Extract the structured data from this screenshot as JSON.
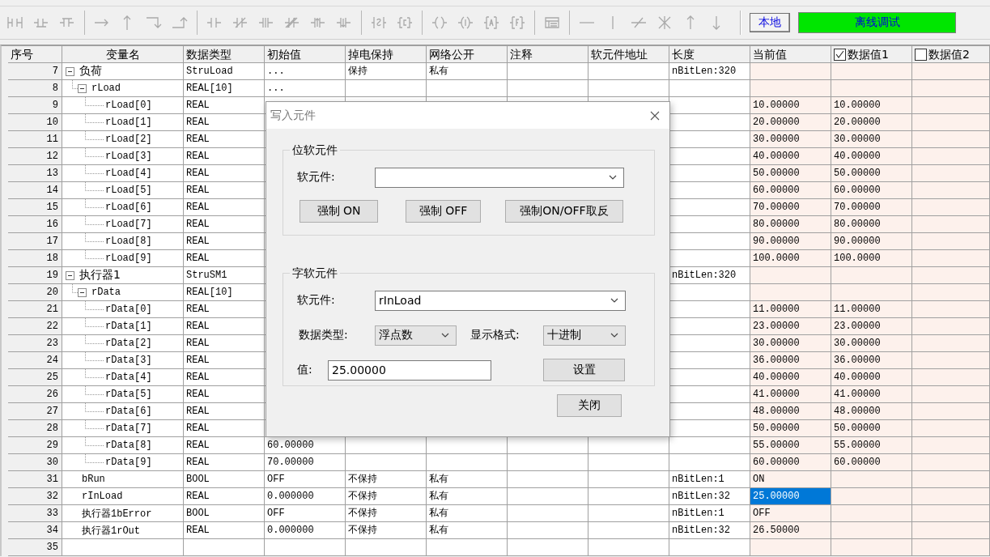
{
  "toolbar": {
    "location_button": "本地",
    "mode_status": "离线调试"
  },
  "table": {
    "columns": [
      {
        "label": "序号",
        "kind": "text"
      },
      {
        "label": "变量名",
        "kind": "text"
      },
      {
        "label": "数据类型",
        "kind": "text"
      },
      {
        "label": "初始值",
        "kind": "text"
      },
      {
        "label": "掉电保持",
        "kind": "text"
      },
      {
        "label": "网络公开",
        "kind": "text"
      },
      {
        "label": "注释",
        "kind": "text"
      },
      {
        "label": "软元件地址",
        "kind": "text"
      },
      {
        "label": "长度",
        "kind": "text"
      },
      {
        "label": "当前值",
        "kind": "text"
      },
      {
        "label": "数据值1",
        "kind": "checkbox",
        "checked": true
      },
      {
        "label": "数据值2",
        "kind": "checkbox",
        "checked": false
      }
    ],
    "rows": [
      {
        "no": "7",
        "name": "负荷",
        "type": "StruLoad",
        "init": "...",
        "retain": "保持",
        "public": "私有",
        "length": "nBitLen:320",
        "selected": false,
        "expanded": true,
        "children": [
          {
            "no": "8",
            "name": "rLoad",
            "type": "REAL[10]",
            "init": "...",
            "selected": false,
            "expanded": true,
            "children": [
              {
                "no": "9",
                "name": "rLoad[0]",
                "type": "REAL",
                "current": "10.00000",
                "data1": "10.00000",
                "selected": false
              },
              {
                "no": "10",
                "name": "rLoad[1]",
                "type": "REAL",
                "current": "20.00000",
                "data1": "20.00000",
                "selected": false
              },
              {
                "no": "11",
                "name": "rLoad[2]",
                "type": "REAL",
                "current": "30.00000",
                "data1": "30.00000",
                "selected": false
              },
              {
                "no": "12",
                "name": "rLoad[3]",
                "type": "REAL",
                "current": "40.00000",
                "data1": "40.00000",
                "selected": false
              },
              {
                "no": "13",
                "name": "rLoad[4]",
                "type": "REAL",
                "current": "50.00000",
                "data1": "50.00000",
                "selected": false
              },
              {
                "no": "14",
                "name": "rLoad[5]",
                "type": "REAL",
                "current": "60.00000",
                "data1": "60.00000",
                "selected": false
              },
              {
                "no": "15",
                "name": "rLoad[6]",
                "type": "REAL",
                "current": "70.00000",
                "data1": "70.00000",
                "selected": false
              },
              {
                "no": "16",
                "name": "rLoad[7]",
                "type": "REAL",
                "current": "80.00000",
                "data1": "80.00000",
                "selected": false
              },
              {
                "no": "17",
                "name": "rLoad[8]",
                "type": "REAL",
                "current": "90.00000",
                "data1": "90.00000",
                "selected": false
              },
              {
                "no": "18",
                "name": "rLoad[9]",
                "type": "REAL",
                "current": "100.0000",
                "data1": "100.0000",
                "selected": false
              }
            ]
          }
        ]
      },
      {
        "no": "19",
        "name": "执行器1",
        "type": "StruSM1",
        "length": "nBitLen:320",
        "selected": false,
        "expanded": true,
        "children": [
          {
            "no": "20",
            "name": "rData",
            "type": "REAL[10]",
            "selected": false,
            "expanded": true,
            "children": [
              {
                "no": "21",
                "name": "rData[0]",
                "type": "REAL",
                "current": "11.00000",
                "data1": "11.00000",
                "selected": false
              },
              {
                "no": "22",
                "name": "rData[1]",
                "type": "REAL",
                "current": "23.00000",
                "data1": "23.00000",
                "selected": false
              },
              {
                "no": "23",
                "name": "rData[2]",
                "type": "REAL",
                "current": "30.00000",
                "data1": "30.00000",
                "selected": false
              },
              {
                "no": "24",
                "name": "rData[3]",
                "type": "REAL",
                "current": "36.00000",
                "data1": "36.00000",
                "selected": false
              },
              {
                "no": "25",
                "name": "rData[4]",
                "type": "REAL",
                "current": "40.00000",
                "data1": "40.00000",
                "selected": false
              },
              {
                "no": "26",
                "name": "rData[5]",
                "type": "REAL",
                "current": "41.00000",
                "data1": "41.00000",
                "selected": false
              },
              {
                "no": "27",
                "name": "rData[6]",
                "type": "REAL",
                "current": "48.00000",
                "data1": "48.00000",
                "selected": false
              },
              {
                "no": "28",
                "name": "rData[7]",
                "type": "REAL",
                "current": "50.00000",
                "data1": "50.00000",
                "selected": false
              },
              {
                "no": "29",
                "name": "rData[8]",
                "type": "REAL",
                "init": "60.00000",
                "current": "55.00000",
                "data1": "55.00000",
                "selected": false
              },
              {
                "no": "30",
                "name": "rData[9]",
                "type": "REAL",
                "init": "70.00000",
                "current": "60.00000",
                "data1": "60.00000",
                "selected": false
              }
            ]
          }
        ]
      },
      {
        "no": "31",
        "name": "bRun",
        "type": "BOOL",
        "init": "OFF",
        "retain": "不保持",
        "public": "私有",
        "length": "nBitLen:1",
        "current": "ON",
        "selected": false
      },
      {
        "no": "32",
        "name": "rInLoad",
        "type": "REAL",
        "init": "0.000000",
        "retain": "不保持",
        "public": "私有",
        "length": "nBitLen:32",
        "current": "25.00000",
        "selected": true
      },
      {
        "no": "33",
        "name": "执行器1bError",
        "type": "BOOL",
        "init": "OFF",
        "retain": "不保持",
        "public": "私有",
        "length": "nBitLen:1",
        "current": "OFF",
        "selected": false
      },
      {
        "no": "34",
        "name": "执行器1rOut",
        "type": "REAL",
        "init": "0.000000",
        "retain": "不保持",
        "public": "私有",
        "length": "nBitLen:32",
        "current": "26.50000",
        "selected": false
      },
      {
        "no": "35",
        "selected": false
      }
    ]
  },
  "dialog": {
    "title": "写入元件",
    "bit_group": {
      "title": "位软元件",
      "device_label": "软元件:",
      "buttons": [
        "强制 ON",
        "强制 OFF",
        "强制ON/OFF取反"
      ]
    },
    "word_group": {
      "title": "字软元件",
      "device_label": "软元件:",
      "device": "rInLoad",
      "type_label": "数据类型:",
      "type": "浮点数",
      "format_label": "显示格式:",
      "format": "十进制",
      "value_label": "值:",
      "value": "25.00000",
      "set_button": "设置"
    },
    "close_button": "关闭"
  }
}
